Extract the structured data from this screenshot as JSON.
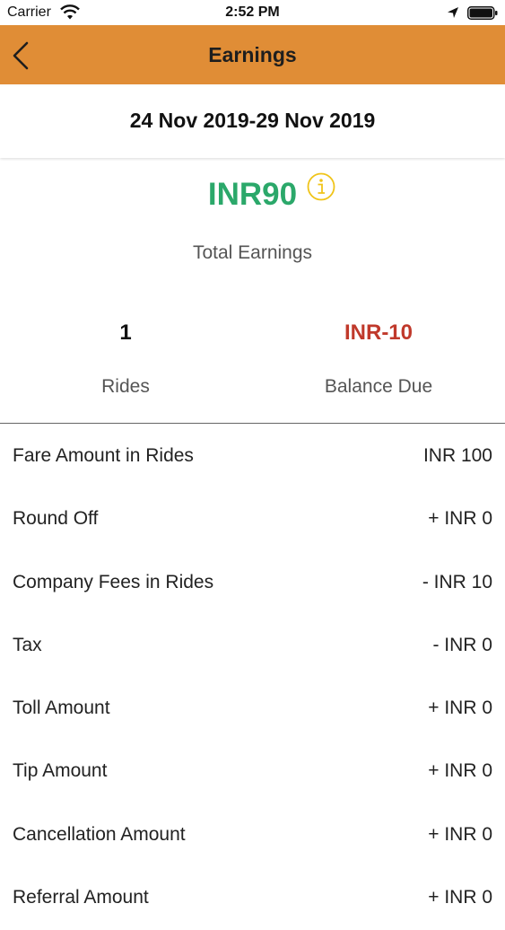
{
  "status_bar": {
    "carrier": "Carrier",
    "time": "2:52 PM"
  },
  "nav": {
    "title": "Earnings",
    "back_icon": "chevron-left-icon"
  },
  "date_range": "24 Nov 2019-29 Nov 2019",
  "summary": {
    "total_amount": "INR90",
    "total_label": "Total Earnings",
    "rides_value": "1",
    "rides_label": "Rides",
    "balance_value": "INR-10",
    "balance_label": "Balance Due"
  },
  "breakdown": [
    {
      "label": "Fare Amount in Rides",
      "value": "INR 100"
    },
    {
      "label": "Round Off",
      "value": "+ INR 0"
    },
    {
      "label": "Company Fees in Rides",
      "value": "- INR 10"
    },
    {
      "label": "Tax",
      "value": "- INR 0"
    },
    {
      "label": "Toll Amount",
      "value": "+ INR 0"
    },
    {
      "label": "Tip Amount",
      "value": "+ INR 0"
    },
    {
      "label": "Cancellation Amount",
      "value": "+ INR 0"
    },
    {
      "label": "Referral Amount",
      "value": "+ INR 0"
    }
  ],
  "colors": {
    "nav_bg": "#e08d36",
    "total_green": "#2ba86a",
    "balance_red": "#c0392b",
    "info_yellow": "#f0c419"
  }
}
